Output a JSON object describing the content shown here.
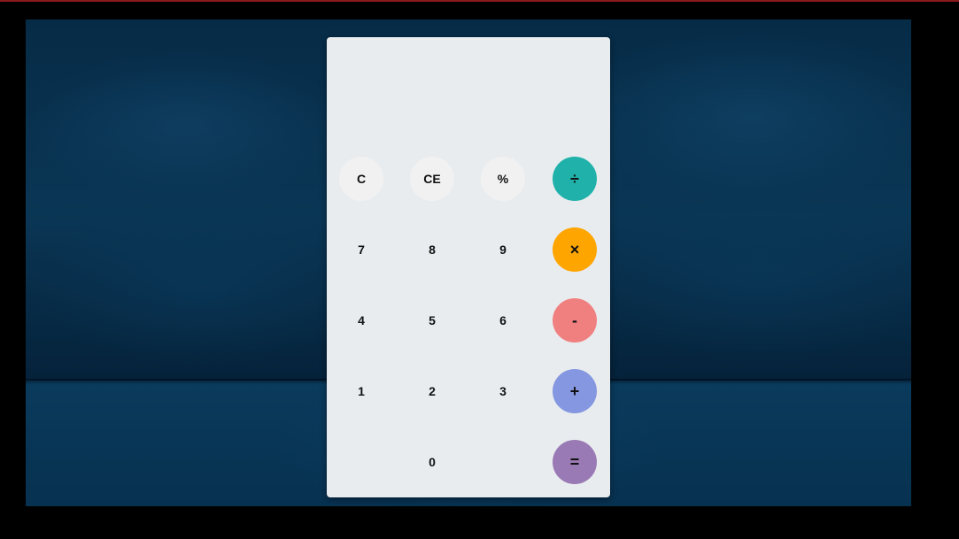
{
  "display": {
    "value": ""
  },
  "keys": {
    "clear": "C",
    "clear_entry": "CE",
    "percent": "%",
    "divide": "÷",
    "seven": "7",
    "eight": "8",
    "nine": "9",
    "multiply": "×",
    "four": "4",
    "five": "5",
    "six": "6",
    "subtract": "-",
    "one": "1",
    "two": "2",
    "three": "3",
    "add": "+",
    "zero": "0",
    "equals": "="
  },
  "colors": {
    "divide": "#20b2aa",
    "multiply": "#ffa500",
    "subtract": "#f08080",
    "add": "#8497e0",
    "equals": "#9a7ab4",
    "function_keys": "#f1f1f1",
    "calculator_body": "#e8ecef"
  }
}
